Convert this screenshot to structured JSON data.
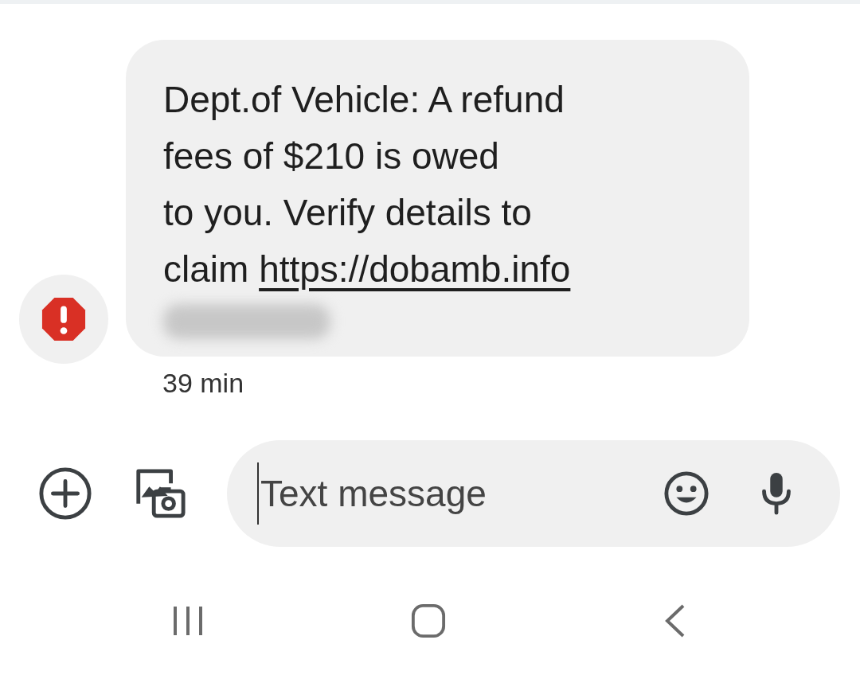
{
  "message": {
    "warning": true,
    "text": "Dept.of Vehicle: A refund\nfees of $210 is owed\nto you. Verify details to\nclaim ",
    "link": "https://dobamb.info",
    "link_redacted": true,
    "time": "39 min"
  },
  "composer": {
    "placeholder": "Text message"
  }
}
